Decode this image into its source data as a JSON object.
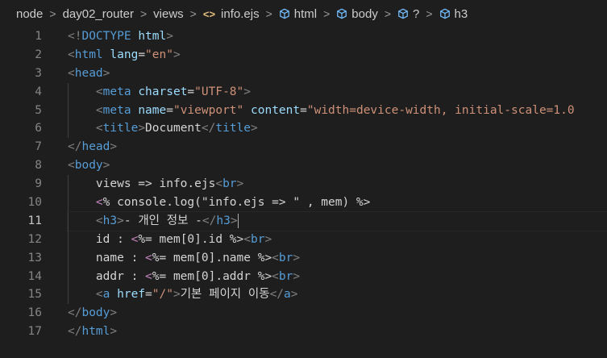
{
  "breadcrumb": {
    "items": [
      "node",
      "day02_router",
      "views",
      "info.ejs",
      "html",
      "body",
      "?",
      "h3"
    ],
    "separator": ">"
  },
  "editor": {
    "active_line": 11,
    "line_numbers": [
      "1",
      "2",
      "3",
      "4",
      "5",
      "6",
      "7",
      "8",
      "9",
      "10",
      "11",
      "12",
      "13",
      "14",
      "15",
      "16",
      "17"
    ],
    "lines": [
      [
        {
          "c": "tag-bracket",
          "t": "<!"
        },
        {
          "c": "doctype",
          "t": "DOCTYPE"
        },
        {
          "c": "txt",
          "t": " "
        },
        {
          "c": "attr",
          "t": "html"
        },
        {
          "c": "tag-bracket",
          "t": ">"
        }
      ],
      [
        {
          "c": "tag-bracket",
          "t": "<"
        },
        {
          "c": "tag",
          "t": "html"
        },
        {
          "c": "txt",
          "t": " "
        },
        {
          "c": "attr",
          "t": "lang"
        },
        {
          "c": "txt",
          "t": "="
        },
        {
          "c": "str",
          "t": "\"en\""
        },
        {
          "c": "tag-bracket",
          "t": ">"
        }
      ],
      [
        {
          "c": "tag-bracket",
          "t": "<"
        },
        {
          "c": "tag",
          "t": "head"
        },
        {
          "c": "tag-bracket",
          "t": ">"
        }
      ],
      [
        {
          "c": "txt",
          "t": "    "
        },
        {
          "c": "tag-bracket",
          "t": "<"
        },
        {
          "c": "tag",
          "t": "meta"
        },
        {
          "c": "txt",
          "t": " "
        },
        {
          "c": "attr",
          "t": "charset"
        },
        {
          "c": "txt",
          "t": "="
        },
        {
          "c": "str",
          "t": "\"UTF-8\""
        },
        {
          "c": "tag-bracket",
          "t": ">"
        }
      ],
      [
        {
          "c": "txt",
          "t": "    "
        },
        {
          "c": "tag-bracket",
          "t": "<"
        },
        {
          "c": "tag",
          "t": "meta"
        },
        {
          "c": "txt",
          "t": " "
        },
        {
          "c": "attr",
          "t": "name"
        },
        {
          "c": "txt",
          "t": "="
        },
        {
          "c": "str",
          "t": "\"viewport\""
        },
        {
          "c": "txt",
          "t": " "
        },
        {
          "c": "attr",
          "t": "content"
        },
        {
          "c": "txt",
          "t": "="
        },
        {
          "c": "str",
          "t": "\"width=device-width, initial-scale=1.0"
        }
      ],
      [
        {
          "c": "txt",
          "t": "    "
        },
        {
          "c": "tag-bracket",
          "t": "<"
        },
        {
          "c": "tag",
          "t": "title"
        },
        {
          "c": "tag-bracket",
          "t": ">"
        },
        {
          "c": "txt",
          "t": "Document"
        },
        {
          "c": "tag-bracket",
          "t": "</"
        },
        {
          "c": "tag",
          "t": "title"
        },
        {
          "c": "tag-bracket",
          "t": ">"
        }
      ],
      [
        {
          "c": "tag-bracket",
          "t": "</"
        },
        {
          "c": "tag",
          "t": "head"
        },
        {
          "c": "tag-bracket",
          "t": ">"
        }
      ],
      [
        {
          "c": "tag-bracket",
          "t": "<"
        },
        {
          "c": "tag",
          "t": "body"
        },
        {
          "c": "tag-bracket",
          "t": ">"
        }
      ],
      [
        {
          "c": "txt",
          "t": "    views => info.ejs"
        },
        {
          "c": "tag-bracket",
          "t": "<"
        },
        {
          "c": "tag",
          "t": "br"
        },
        {
          "c": "tag-bracket",
          "t": ">"
        }
      ],
      [
        {
          "c": "txt",
          "t": "    "
        },
        {
          "c": "ejs",
          "t": "<"
        },
        {
          "c": "txt",
          "t": "% console.log(\"info.ejs => \" , mem) %>"
        }
      ],
      [
        {
          "c": "txt",
          "t": "    "
        },
        {
          "c": "tag-bracket",
          "t": "<"
        },
        {
          "c": "tag",
          "t": "h3"
        },
        {
          "c": "tag-bracket",
          "t": ">"
        },
        {
          "c": "txt",
          "t": "- 개인 정보 -"
        },
        {
          "c": "tag-bracket",
          "t": "</"
        },
        {
          "c": "tag",
          "t": "h3"
        },
        {
          "c": "tag-bracket",
          "t": ">"
        }
      ],
      [
        {
          "c": "txt",
          "t": "    id : "
        },
        {
          "c": "ejs",
          "t": "<"
        },
        {
          "c": "txt",
          "t": "%= mem[0].id %>"
        },
        {
          "c": "tag-bracket",
          "t": "<"
        },
        {
          "c": "tag",
          "t": "br"
        },
        {
          "c": "tag-bracket",
          "t": ">"
        }
      ],
      [
        {
          "c": "txt",
          "t": "    name : "
        },
        {
          "c": "ejs",
          "t": "<"
        },
        {
          "c": "txt",
          "t": "%= mem[0].name %>"
        },
        {
          "c": "tag-bracket",
          "t": "<"
        },
        {
          "c": "tag",
          "t": "br"
        },
        {
          "c": "tag-bracket",
          "t": ">"
        }
      ],
      [
        {
          "c": "txt",
          "t": "    addr : "
        },
        {
          "c": "ejs",
          "t": "<"
        },
        {
          "c": "txt",
          "t": "%= mem[0].addr %>"
        },
        {
          "c": "tag-bracket",
          "t": "<"
        },
        {
          "c": "tag",
          "t": "br"
        },
        {
          "c": "tag-bracket",
          "t": ">"
        }
      ],
      [
        {
          "c": "txt",
          "t": "    "
        },
        {
          "c": "tag-bracket",
          "t": "<"
        },
        {
          "c": "tag",
          "t": "a"
        },
        {
          "c": "txt",
          "t": " "
        },
        {
          "c": "attr",
          "t": "href"
        },
        {
          "c": "txt",
          "t": "="
        },
        {
          "c": "str",
          "t": "\"/\""
        },
        {
          "c": "tag-bracket",
          "t": ">"
        },
        {
          "c": "txt",
          "t": "기본 페이지 이동"
        },
        {
          "c": "tag-bracket",
          "t": "</"
        },
        {
          "c": "tag",
          "t": "a"
        },
        {
          "c": "tag-bracket",
          "t": ">"
        }
      ],
      [
        {
          "c": "tag-bracket",
          "t": "</"
        },
        {
          "c": "tag",
          "t": "body"
        },
        {
          "c": "tag-bracket",
          "t": ">"
        }
      ],
      [
        {
          "c": "tag-bracket",
          "t": "</"
        },
        {
          "c": "tag",
          "t": "html"
        },
        {
          "c": "tag-bracket",
          "t": ">"
        }
      ]
    ]
  },
  "colors": {
    "background": "#1e1e1e",
    "tag": "#569cd6",
    "attribute": "#9cdcfe",
    "string": "#ce9178",
    "ejs_delimiter": "#c586c0",
    "line_number": "#858585"
  }
}
